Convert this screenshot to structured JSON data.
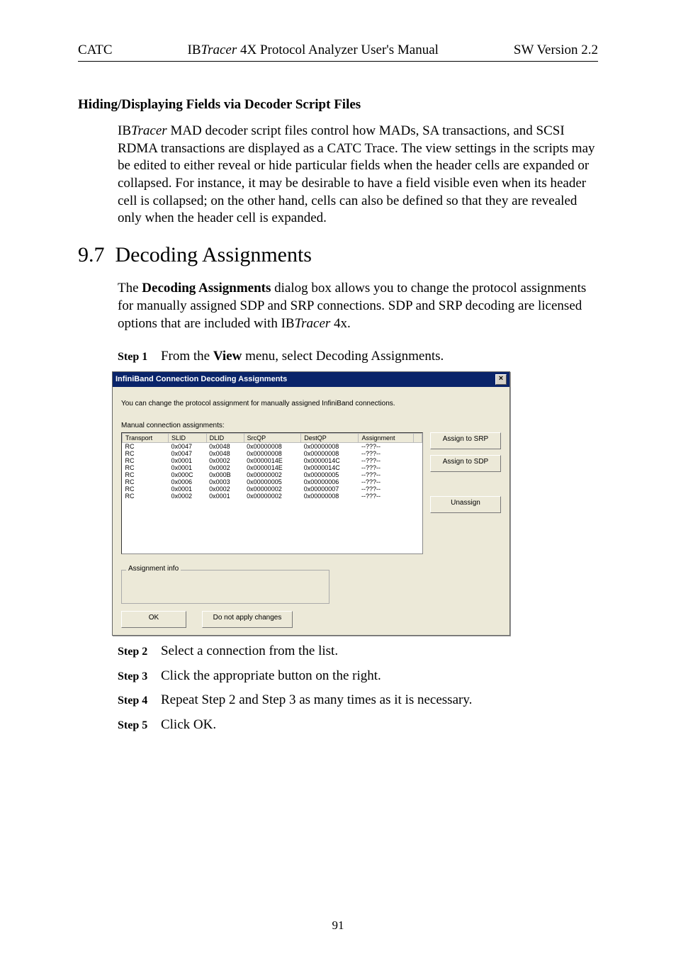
{
  "header": {
    "left": "CATC",
    "center_prefix": "IB",
    "center_italic": "Tracer",
    "center_suffix": " 4X Protocol Analyzer User's Manual",
    "right": "SW Version 2.2"
  },
  "subheading": "Hiding/Displaying Fields via Decoder Script Files",
  "para1_pre": "IB",
  "para1_italic": "Tracer",
  "para1_rest": " MAD decoder script files control how MADs, SA transactions, and SCSI RDMA transactions are displayed as a CATC Trace.  The view settings in the scripts may be edited to either reveal or hide particular fields when the header cells are expanded or collapsed. For instance, it may be desirable to have a field visible even when its header cell is collapsed; on the other hand, cells can also be defined so that they are revealed only when the header cell is expanded.",
  "section_number": "9.7",
  "section_title": "Decoding Assignments",
  "para2_pre": "The ",
  "para2_bold": "Decoding Assignments",
  "para2_mid": " dialog box allows you to change the protocol assignments for manually assigned SDP and SRP connections. SDP and SRP decoding are licensed options that are included with IB",
  "para2_italic": "Tracer",
  "para2_suffix": " 4x.",
  "steps": [
    {
      "label": "Step 1",
      "pre": "From the ",
      "bold": "View",
      "post": " menu, select Decoding Assignments."
    },
    {
      "label": "Step 2",
      "text": "Select a connection from the list."
    },
    {
      "label": "Step 3",
      "text": "Click the appropriate button on the right."
    },
    {
      "label": "Step 4",
      "text": "Repeat Step 2 and Step 3 as many times as it is necessary."
    },
    {
      "label": "Step 5",
      "text": "Click OK."
    }
  ],
  "dialog": {
    "title": "InfiniBand Connection Decoding Assignments",
    "close_glyph": "×",
    "subtext": "You can change the protocol assignment for manually assigned InfiniBand connections.",
    "listlabel": "Manual connection assignments:",
    "columns": [
      "Transport",
      "SLID",
      "DLID",
      "SrcQP",
      "DestQP",
      "Assignment",
      ""
    ],
    "rows": [
      [
        "RC",
        "0x0047",
        "0x0048",
        "0x00000008",
        "0x00000008",
        "--???--"
      ],
      [
        "RC",
        "0x0047",
        "0x0048",
        "0x00000008",
        "0x00000008",
        "--???--"
      ],
      [
        "RC",
        "0x0001",
        "0x0002",
        "0x0000014E",
        "0x0000014C",
        "--???--"
      ],
      [
        "RC",
        "0x0001",
        "0x0002",
        "0x0000014E",
        "0x0000014C",
        "--???--"
      ],
      [
        "RC",
        "0x000C",
        "0x000B",
        "0x00000002",
        "0x00000005",
        "--???--"
      ],
      [
        "RC",
        "0x0006",
        "0x0003",
        "0x00000005",
        "0x00000006",
        "--???--"
      ],
      [
        "RC",
        "0x0001",
        "0x0002",
        "0x00000002",
        "0x00000007",
        "--???--"
      ],
      [
        "RC",
        "0x0002",
        "0x0001",
        "0x00000002",
        "0x00000008",
        "--???--"
      ]
    ],
    "buttons": {
      "assign_srp": "Assign to SRP",
      "assign_sdp": "Assign to SDP",
      "unassign": "Unassign"
    },
    "fieldset_label": "Assignment info",
    "ok": "OK",
    "cancel": "Do not apply changes"
  },
  "page_number": "91"
}
